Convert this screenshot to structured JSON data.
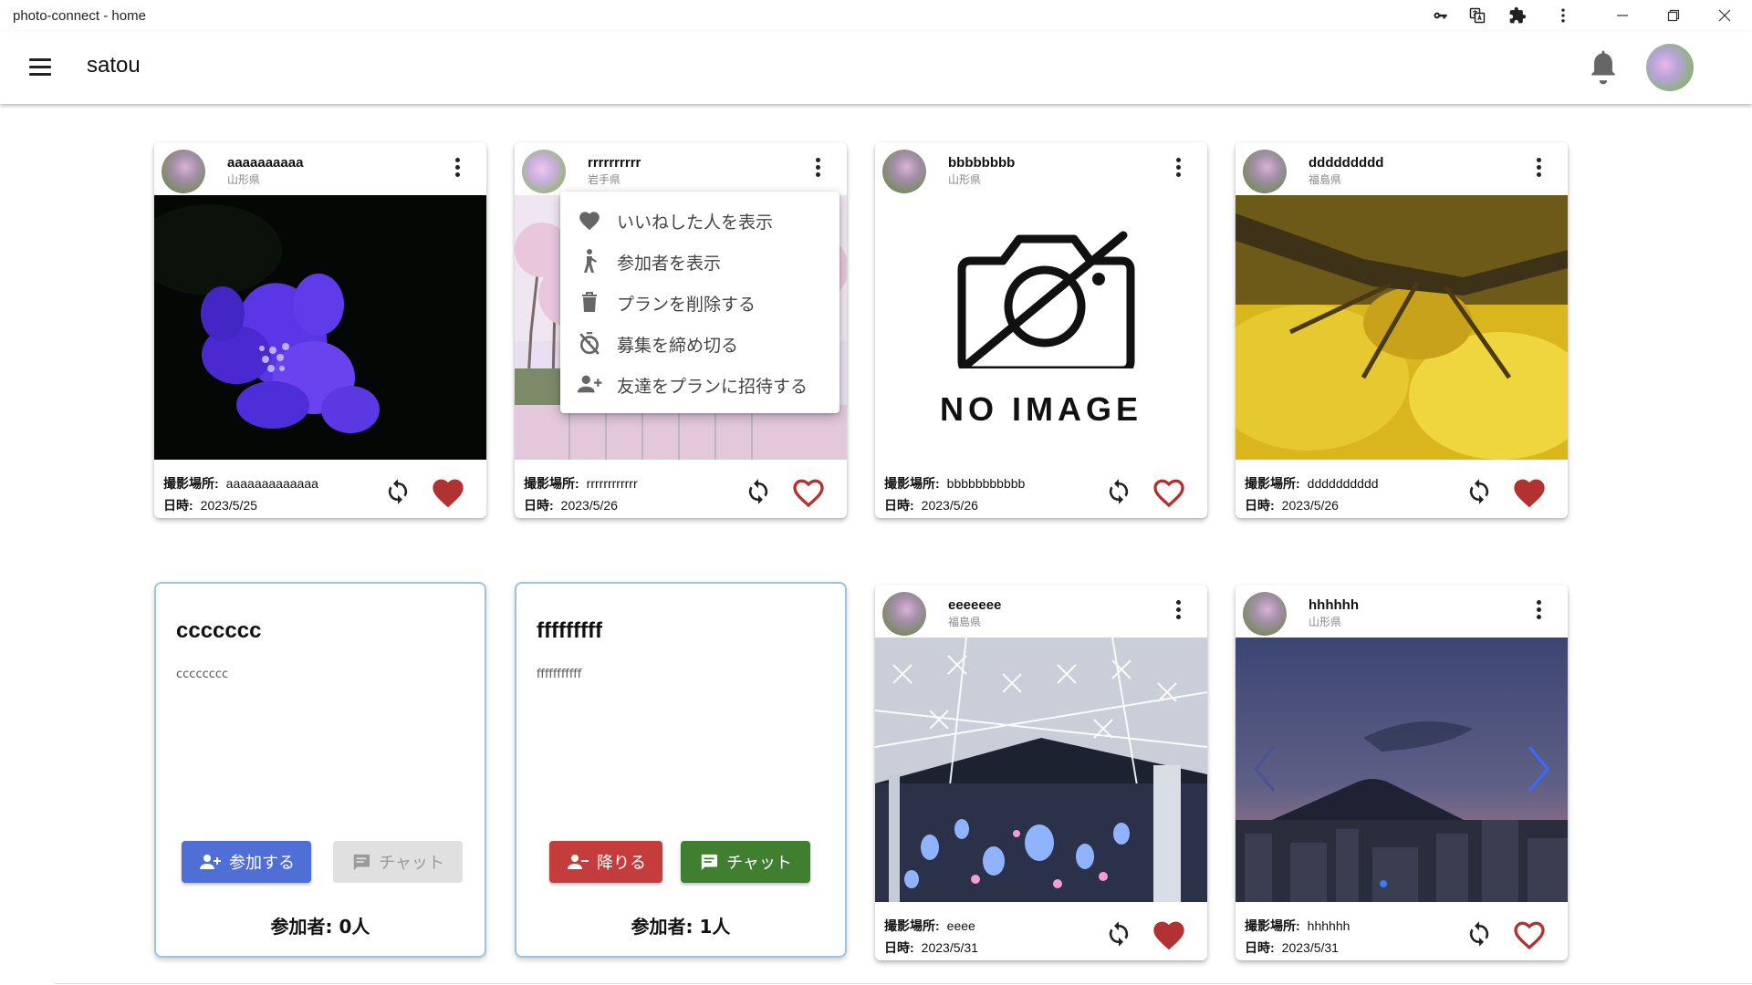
{
  "window": {
    "title": "photo-connect - home",
    "icons": [
      "key-icon",
      "translate-icon",
      "extension-icon",
      "more-vert-icon"
    ],
    "controls": [
      "minimize-icon",
      "restore-icon",
      "close-icon"
    ]
  },
  "appbar": {
    "title": "satou",
    "icons": [
      "menu-icon",
      "bell-icon",
      "avatar"
    ]
  },
  "labels": {
    "location": "撮影場所:",
    "date": "日時:",
    "participants": "参加者:"
  },
  "posts": [
    {
      "user": "aaaaaaaaaa",
      "prefecture": "山形県",
      "location": "aaaaaaaaaaaaa",
      "date": "2023/5/25",
      "liked": true,
      "image": "hydrangea-photo"
    },
    {
      "user": "rrrrrrrrrr",
      "prefecture": "岩手県",
      "location": "rrrrrrrrrrrr",
      "date": "2023/5/26",
      "liked": false,
      "image": "cherry-blossom-photo"
    },
    {
      "user": "bbbbbbbb",
      "prefecture": "山形県",
      "location": "bbbbbbbbbbb",
      "date": "2023/5/26",
      "liked": false,
      "image": "no-image-placeholder",
      "no_image_text": "NO IMAGE"
    },
    {
      "user": "ddddddddd",
      "prefecture": "福島県",
      "location": "dddddddddd",
      "date": "2023/5/26",
      "liked": true,
      "image": "ginkgo-tree-photo"
    },
    {
      "user": "eeeeeee",
      "prefecture": "福島県",
      "location": "eeee",
      "date": "2023/5/31",
      "liked": true,
      "image": "illumination-photo"
    },
    {
      "user": "hhhhhh",
      "prefecture": "山形県",
      "location": "hhhhhh",
      "date": "2023/5/31",
      "liked": false,
      "image": "volcano-dusk-photo"
    }
  ],
  "plans": [
    {
      "title": "ccccccc",
      "description": "cccccccc",
      "join_label": "参加する",
      "chat_label": "チャット",
      "chat_enabled": false,
      "count": "0人",
      "join_color": "#4f6fd6"
    },
    {
      "title": "fffffffff",
      "description": "fffffffffff",
      "join_label": "降りる",
      "chat_label": "チャット",
      "chat_enabled": true,
      "count": "1人",
      "join_color": "#c43c3c",
      "chat_color": "#3f7f2f"
    }
  ],
  "context_menu": {
    "items": [
      {
        "label": "いいねした人を表示",
        "icon": "heart-icon"
      },
      {
        "label": "参加者を表示",
        "icon": "person-icon"
      },
      {
        "label": "プランを削除する",
        "icon": "trash-icon"
      },
      {
        "label": "募集を締め切る",
        "icon": "timer-off-icon"
      },
      {
        "label": "友達をプランに招待する",
        "icon": "person-add-icon"
      }
    ]
  },
  "colors": {
    "heart": "#b23232",
    "plan_border": "#9ec3de",
    "disabled_button": "#e0e0e0"
  }
}
